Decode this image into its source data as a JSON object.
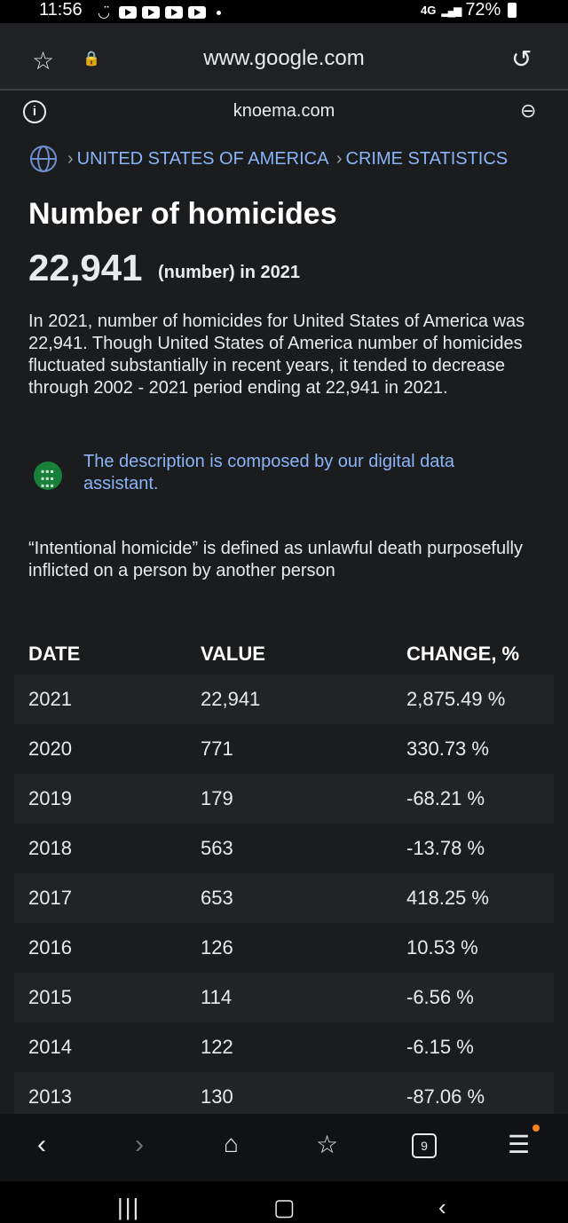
{
  "status": {
    "time": "11:56",
    "network": "4G",
    "battery": "72%"
  },
  "browser": {
    "url": "www.google.com",
    "site_domain": "knoema.com",
    "tab_count": "9"
  },
  "breadcrumb": {
    "items": [
      "UNITED STATES OF AMERICA",
      "CRIME STATISTICS"
    ]
  },
  "article": {
    "title": "Number of homicides",
    "value": "22,941",
    "unit": "(number) in 2021",
    "description": "In 2021, number of homicides for United States of America was 22,941. Though United States of America number of homicides fluctuated substantially in recent years, it tended to decrease through 2002 - 2021 period ending at 22,941 in 2021.",
    "assistant_note": "The description is composed by our digital data assistant.",
    "definition": "“Intentional homicide” is defined as unlawful death purposefully inflicted on a person by another person"
  },
  "table": {
    "headers": [
      "DATE",
      "VALUE",
      "CHANGE, %"
    ],
    "rows": [
      [
        "2021",
        "22,941",
        "2,875.49 %"
      ],
      [
        "2020",
        "771",
        "330.73 %"
      ],
      [
        "2019",
        "179",
        "-68.21 %"
      ],
      [
        "2018",
        "563",
        "-13.78 %"
      ],
      [
        "2017",
        "653",
        "418.25 %"
      ],
      [
        "2016",
        "126",
        "10.53 %"
      ],
      [
        "2015",
        "114",
        "-6.56 %"
      ],
      [
        "2014",
        "122",
        "-6.15 %"
      ],
      [
        "2013",
        "130",
        "-87.06 %"
      ]
    ]
  },
  "colors": {
    "background": "#1b1c1e",
    "link": "#8ab4f8",
    "assistant_icon": "#188038",
    "menu_badge": "#f4821f"
  }
}
